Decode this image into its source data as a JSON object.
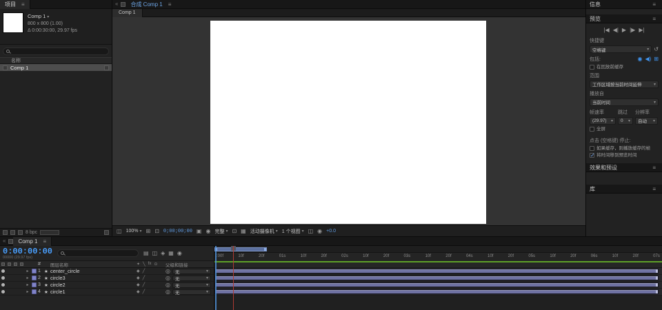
{
  "colors": {
    "accent_blue": "#3f96f0",
    "timecode_blue": "#4aa0ff",
    "cache_green": "#5ea028",
    "layer_bar": "#6f72a3"
  },
  "icons": {
    "menu": "≡",
    "caret": "▾",
    "chevron": "«",
    "expander": "▸",
    "star": "★",
    "pickwhip": "◎",
    "first_frame": "|◀",
    "prev_frame": "◀|",
    "play": "▶",
    "next_frame": "|▶",
    "last_frame": "▶|",
    "reset": "↺",
    "inc_video": "◉",
    "inc_audio": "◀)",
    "inc_overlays": "⊞",
    "grid": "⊞",
    "snapshot": "▣",
    "show_snapshot": "◉",
    "roi": "⊡",
    "transparency": "▦",
    "pixel_aspect": "◫",
    "flowchart": "▤",
    "draft3d": "◫",
    "shy": "◈",
    "frame_blend": "▦",
    "motion_blur": "◉",
    "sw_collapse": "✦",
    "sw_quality": "╲",
    "sw_fx": "fx",
    "sw_adj": "⊙",
    "row_collapse": "◆",
    "row_quality": "╱"
  },
  "project": {
    "tab": "项目",
    "selected": {
      "name": "Comp 1",
      "dimensions": "800 x 800 (1.00)",
      "details": "Δ 0:00:30:00, 29.97 fps"
    },
    "columns": {
      "name": "名称"
    },
    "items": [
      {
        "name": "Comp 1"
      }
    ],
    "footer": {
      "depth": "8 bpc"
    }
  },
  "viewer": {
    "tab": "合成 Comp 1",
    "comp_tab": "Comp 1",
    "toolbar": {
      "zoom": "100%",
      "timecode": "0;00;00;00",
      "resolution": "完整",
      "camera": "活动摄像机",
      "views": "1 个视图",
      "exposure": "+0.0"
    }
  },
  "right": {
    "info_tab": "信息",
    "preview_tab": "预览",
    "shortcut_label": "快捷键",
    "shortcut_value": "空格键",
    "include_label": "包括:",
    "cache_option": "在回放前缓存",
    "range_label": "范围",
    "range_value": "工作区域按当前时间延伸",
    "play_from_label": "播放自",
    "play_from_value": "当前时间",
    "framerate_label": "帧速率",
    "skip_label": "跳过",
    "resolution_label": "分辨率",
    "framerate_value": "(29.97)",
    "skip_value": "0",
    "resolution_value": "自动",
    "fullscreen_option": "全屏",
    "stop_heading": "点击 (空格键) 停止:",
    "stop_option_cache": "如果缓存，则播放缓存的帧",
    "stop_option_move": "将时间移到预览时间",
    "effects_tab": "效果和预设",
    "libraries_tab": "库"
  },
  "timeline": {
    "tab": "Comp 1",
    "timecode": "0:00:00:00",
    "timecode_sub": "00000 (29.97 fps)",
    "columns": {
      "number": "#",
      "layer_name": "图层名称",
      "parent": "父级和链接"
    },
    "layers": [
      {
        "number": "1",
        "name": "center_circle",
        "parent": "无"
      },
      {
        "number": "2",
        "name": "circle3",
        "parent": "无"
      },
      {
        "number": "3",
        "name": "circle2",
        "parent": "无"
      },
      {
        "number": "4",
        "name": "circle1",
        "parent": "无"
      }
    ],
    "ruler_labels": [
      ":00f",
      "10f",
      "20f",
      "01s",
      "10f",
      "20f",
      "02s",
      "10f",
      "20f",
      "03s",
      "10f",
      "20f",
      "04s",
      "10f",
      "20f",
      "05s",
      "10f",
      "20f",
      "06s",
      "10f",
      "20f",
      "07s"
    ]
  }
}
